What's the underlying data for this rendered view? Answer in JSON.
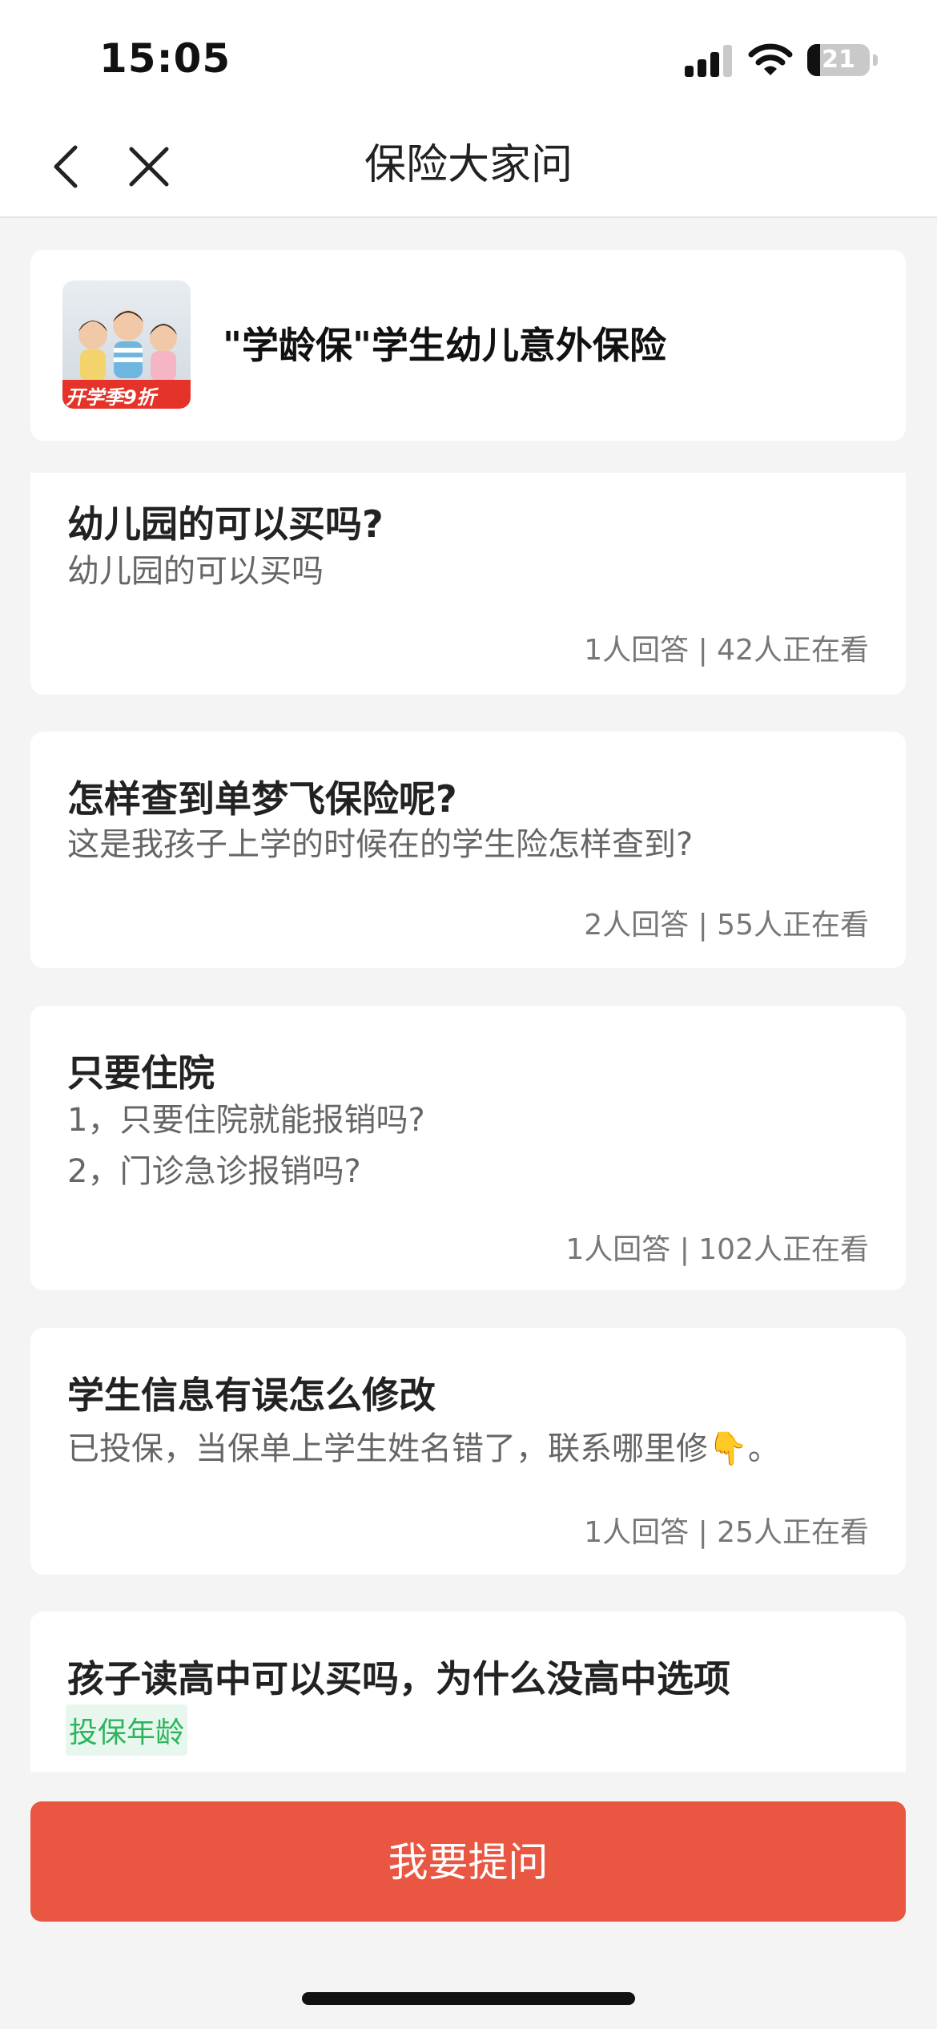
{
  "status_bar": {
    "time": "15:05",
    "battery": "21",
    "battery_level": 0.21
  },
  "nav": {
    "title": "保险大家问"
  },
  "product": {
    "title": "\"学龄保\"学生幼儿意外保险",
    "badge": "开学季9折"
  },
  "questions": [
    {
      "title": "幼儿园的可以买吗?",
      "desc": "幼儿园的可以买吗",
      "meta": "1人回答 | 42人正在看"
    },
    {
      "title": "怎样查到单梦飞保险呢?",
      "desc": "这是我孩子上学的时候在的学生险怎样查到?",
      "meta": "2人回答 | 55人正在看"
    },
    {
      "title": "只要住院",
      "desc_lines": [
        "1，只要住院就能报销吗?",
        "2，门诊急诊报销吗?"
      ],
      "meta": "1人回答 | 102人正在看"
    },
    {
      "title": "学生信息有误怎么修改",
      "desc": "已投保，当保单上学生姓名错了，联系哪里修",
      "desc_emoji": "👇",
      "desc_end": "。",
      "meta": "1人回答 | 25人正在看"
    },
    {
      "title": "孩子读高中可以买吗，为什么没高中选项",
      "tag": "投保年龄"
    }
  ],
  "ask_button": {
    "label": "我要提问"
  },
  "colors": {
    "accent": "#e95743",
    "tag_text": "#2db55d",
    "tag_bg": "#e8f7ee"
  }
}
